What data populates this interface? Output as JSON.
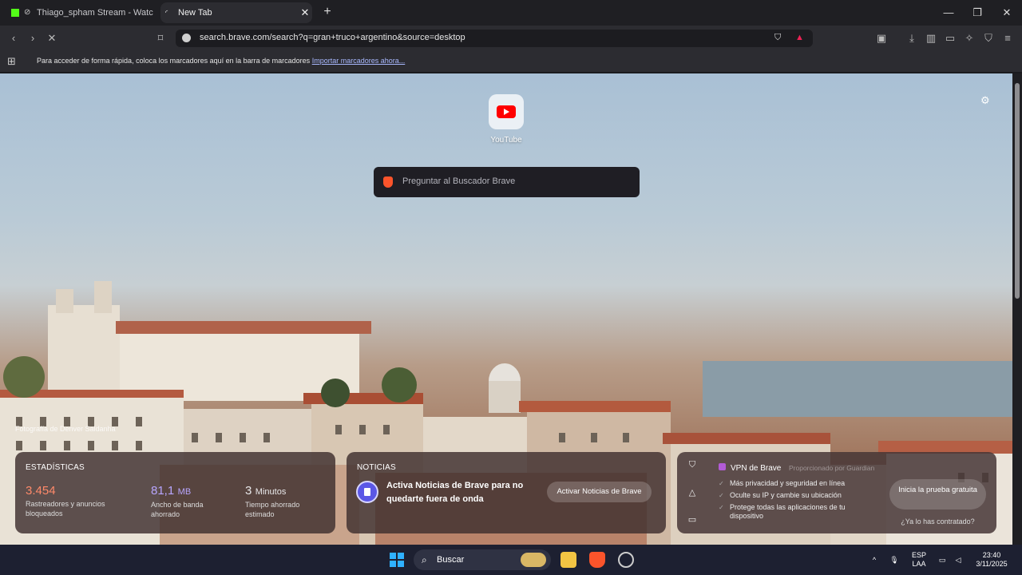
{
  "browser": {
    "tabs": [
      {
        "title": "Thiago_spham Stream - Watch Li",
        "active": false
      },
      {
        "title": "New Tab",
        "active": true
      }
    ],
    "url": "search.brave.com/search?q=gran+truco+argentino&source=desktop",
    "bookmarks_message": "Para acceder de forma rápida, coloca los marcadores aquí en la barra de marcadores",
    "bookmarks_link": "Importar marcadores ahora..."
  },
  "newtab": {
    "top_site_label": "YouTube",
    "search_placeholder": "Preguntar al Buscador Brave",
    "photo_credit": "Fotografía de Denver Saldanha"
  },
  "stats": {
    "title": "ESTADÍSTICAS",
    "trackers": {
      "value": "3.454",
      "label": "Rastreadores y anuncios bloqueados",
      "color": "#ff8a6a"
    },
    "bandwidth": {
      "value": "81,1",
      "unit": "MB",
      "label": "Ancho de banda ahorrado",
      "color": "#b8a6ff"
    },
    "time": {
      "value": "3",
      "unit": "Minutos",
      "label": "Tiempo ahorrado estimado",
      "color": "#ffffff"
    }
  },
  "news": {
    "title": "NOTICIAS",
    "text": "Activa Noticias de Brave para no quedarte fuera de onda",
    "button": "Activar Noticias de Brave"
  },
  "vpn": {
    "title": "VPN de Brave",
    "provider": "Proporcionado por Guardian",
    "features": [
      "Más privacidad y seguridad en línea",
      "Oculte su IP y cambie su ubicación",
      "Protege todas las aplicaciones de tu dispositivo"
    ],
    "button": "Inicia la prueba gratuita",
    "link": "¿Ya lo has contratado?"
  },
  "taskbar": {
    "search_label": "Buscar",
    "language": "ESP",
    "layout": "LAA",
    "time": "23:40",
    "date": "3/11/2025"
  }
}
